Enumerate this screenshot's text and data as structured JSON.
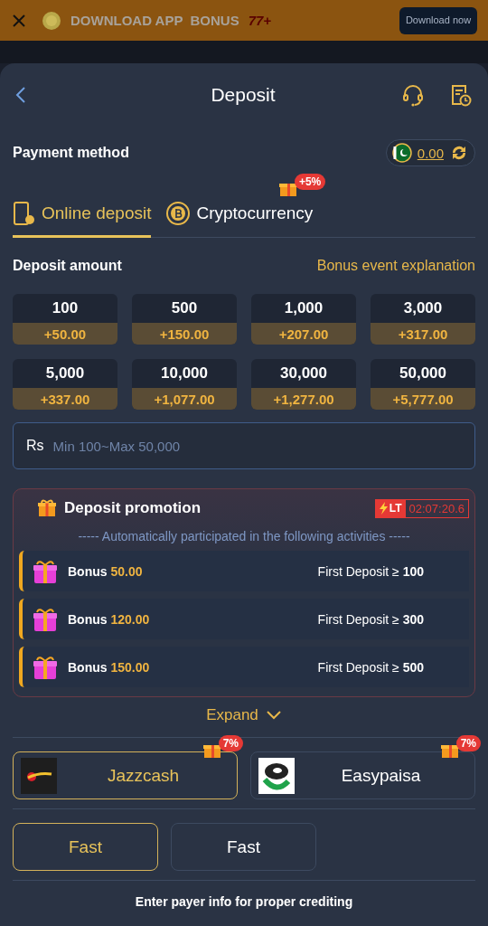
{
  "banner": {
    "text": "DOWNLOAD APP  BONUS",
    "bonus": "77+",
    "button": "Download now"
  },
  "header": {
    "title": "Deposit"
  },
  "payment": {
    "label": "Payment method",
    "balance": "0.00"
  },
  "tabs": [
    {
      "label": "Online deposit",
      "selected": true,
      "kind": "phone"
    },
    {
      "label": "Cryptocurrency",
      "selected": false,
      "kind": "coin",
      "badge": "+5%"
    }
  ],
  "amount_section": {
    "label": "Deposit amount",
    "link": "Bonus event explanation"
  },
  "amounts": [
    {
      "amount": "100",
      "bonus": "+50.00"
    },
    {
      "amount": "500",
      "bonus": "+150.00"
    },
    {
      "amount": "1,000",
      "bonus": "+207.00"
    },
    {
      "amount": "3,000",
      "bonus": "+317.00"
    },
    {
      "amount": "5,000",
      "bonus": "+337.00"
    },
    {
      "amount": "10,000",
      "bonus": "+1,077.00"
    },
    {
      "amount": "30,000",
      "bonus": "+1,277.00"
    },
    {
      "amount": "50,000",
      "bonus": "+5,777.00"
    }
  ],
  "amount_field": {
    "currency": "Rs",
    "placeholder": "Min 100~Max 50,000"
  },
  "promotion": {
    "title": "Deposit promotion",
    "tag": "LT",
    "timer": "02:07:20.6",
    "subtitle": "----- Automatically participated in the following activities -----",
    "rows": [
      {
        "label": "Bonus",
        "amount": "50.00",
        "condition": "First Deposit ≥",
        "threshold": "100"
      },
      {
        "label": "Bonus",
        "amount": "120.00",
        "condition": "First Deposit ≥",
        "threshold": "300"
      },
      {
        "label": "Bonus",
        "amount": "150.00",
        "condition": "First Deposit ≥",
        "threshold": "500"
      }
    ]
  },
  "expand": "Expand",
  "methods": [
    {
      "name": "Jazzcash",
      "badge": "7%",
      "selected": true,
      "kind": "jazzcash"
    },
    {
      "name": "Easypaisa",
      "badge": "7%",
      "selected": false,
      "kind": "easypaisa"
    }
  ],
  "channels": [
    {
      "label": "Fast",
      "selected": true
    },
    {
      "label": "Fast",
      "selected": false
    }
  ],
  "note": "Enter payer info for proper crediting"
}
